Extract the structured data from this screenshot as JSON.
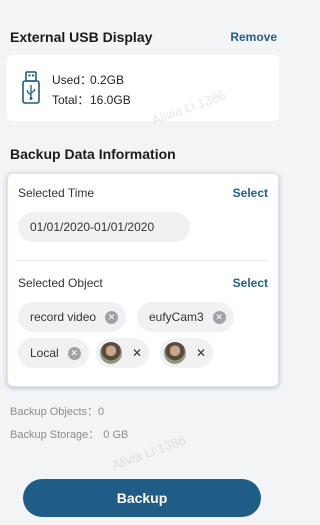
{
  "external_usb": {
    "title": "External USB Display",
    "remove_label": "Remove",
    "used_label": "Used：",
    "used_value": "0.2GB",
    "total_label": "Total：",
    "total_value": "16.0GB"
  },
  "backup_info": {
    "title": "Backup Data Information",
    "selected_time_label": "Selected Time",
    "select_time_link": "Select",
    "time_range": "01/01/2020-01/01/2020",
    "selected_object_label": "Selected Object",
    "select_object_link": "Select",
    "chips": [
      "record video",
      "eufyCam3",
      "Local"
    ]
  },
  "summary": {
    "objects_label": "Backup Objects：",
    "objects_value": "0",
    "storage_label": "Backup Storage：",
    "storage_value": "0 GB"
  },
  "watermark": "Alivia Li 1386",
  "backup_button": "Backup",
  "colors": {
    "accent": "#1f5d86",
    "link": "#1e5f8c"
  }
}
